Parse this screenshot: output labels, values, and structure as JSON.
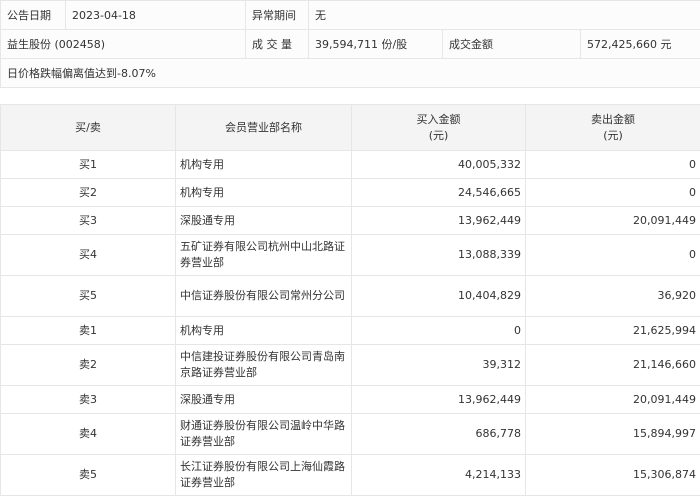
{
  "info": {
    "date_label": "公告日期",
    "date": "2023-04-18",
    "period_label": "异常期间",
    "period": "无",
    "stock": "益生股份 (002458)",
    "volume_label": "成 交 量",
    "volume": "39,594,711 份/股",
    "amount_label": "成交金额",
    "amount": "572,425,660 元",
    "reason": "日价格跌幅偏离值达到-8.07%"
  },
  "table": {
    "headers": [
      "买/卖",
      "会员营业部名称",
      "买入金额\n(元)",
      "卖出金额\n(元)"
    ],
    "rows": [
      {
        "side": "买1",
        "name": "机构专用",
        "buy": "40,005,332",
        "sell": "0"
      },
      {
        "side": "买2",
        "name": "机构专用",
        "buy": "24,546,665",
        "sell": "0"
      },
      {
        "side": "买3",
        "name": "深股通专用",
        "buy": "13,962,449",
        "sell": "20,091,449"
      },
      {
        "side": "买4",
        "name": "五矿证券有限公司杭州中山北路证券营业部",
        "buy": "13,088,339",
        "sell": "0"
      },
      {
        "side": "买5",
        "name": "中信证券股份有限公司常州分公司",
        "buy": "10,404,829",
        "sell": "36,920"
      },
      {
        "side": "卖1",
        "name": "机构专用",
        "buy": "0",
        "sell": "21,625,994"
      },
      {
        "side": "卖2",
        "name": "中信建投证券股份有限公司青岛南京路证券营业部",
        "buy": "39,312",
        "sell": "21,146,660"
      },
      {
        "side": "卖3",
        "name": "深股通专用",
        "buy": "13,962,449",
        "sell": "20,091,449"
      },
      {
        "side": "卖4",
        "name": "财通证券股份有限公司温岭中华路证券营业部",
        "buy": "686,778",
        "sell": "15,894,997"
      },
      {
        "side": "卖5",
        "name": "长江证券股份有限公司上海仙霞路证券营业部",
        "buy": "4,214,133",
        "sell": "15,306,874"
      }
    ]
  }
}
